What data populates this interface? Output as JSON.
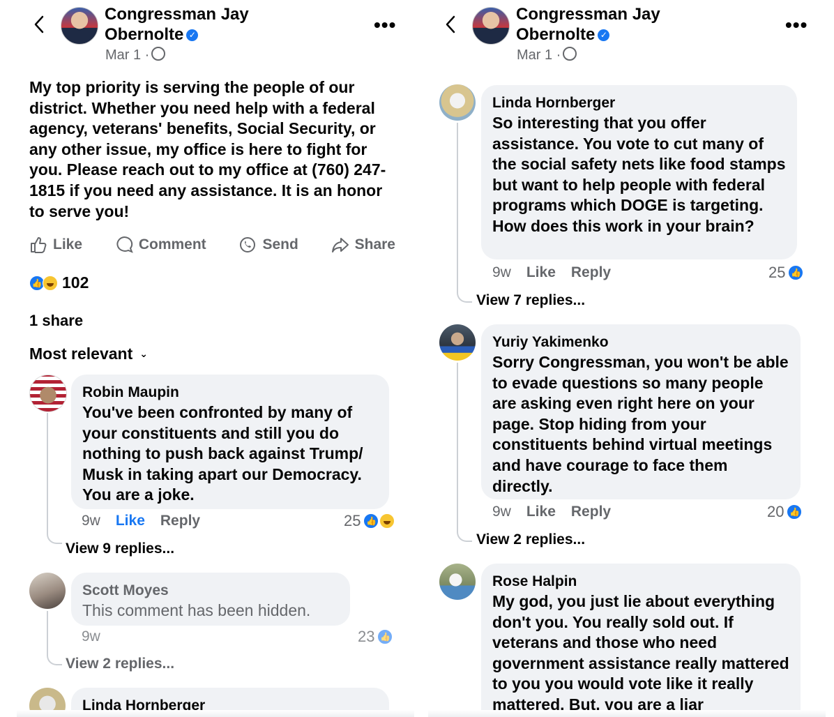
{
  "post": {
    "author": "Congressman Jay Obernolte",
    "author_line1": "Congressman Jay",
    "author_line2": "Obernolte",
    "date": "Mar 1 ·",
    "text": "My top priority is serving the people of our district. Whether you need help with a federal agency, veterans' benefits, Social Security, or any other issue, my office is here to fight for you. Please reach out to my office at (760) 247-1815 if you need any assistance. It is an honor to serve you!",
    "actions": {
      "like": "Like",
      "comment": "Comment",
      "send": "Send",
      "share": "Share"
    },
    "reaction_count": "102",
    "shares": "1 share",
    "sort_label": "Most relevant"
  },
  "left_comments": [
    {
      "name": "Robin Maupin",
      "text": "You've been confronted by many of your constituents and still you do nothing to push back against Trump/ Musk in taking apart our Democracy. You are a joke.",
      "time": "9w",
      "like": "Like",
      "reply": "Reply",
      "count": "25",
      "view_replies": "View 9 replies..."
    },
    {
      "name": "Scott Moyes",
      "text": "This comment has been hidden.",
      "time": "9w",
      "count": "23",
      "view_replies": "View 2 replies..."
    },
    {
      "name": "Linda Hornberger"
    }
  ],
  "right_comments": [
    {
      "name": "Linda Hornberger",
      "text": "So interesting that you offer assistance.  You vote to cut many of the social safety nets like food stamps but want to help people with federal programs which DOGE is targeting. How does this work in your brain?",
      "time": "9w",
      "like": "Like",
      "reply": "Reply",
      "count": "25",
      "view_replies": "View 7 replies..."
    },
    {
      "name": "Yuriy Yakimenko",
      "text": "Sorry Congressman, you won't be able to evade questions so many people are asking even right here on your page. Stop hiding from your constituents behind virtual meetings and have courage to face them directly.",
      "time": "9w",
      "like": "Like",
      "reply": "Reply",
      "count": "20",
      "view_replies": "View 2 replies..."
    },
    {
      "name": "Rose Halpin",
      "text": "My god, you just lie about everything don't you.  You really sold out.  If veterans and those who need government assistance really mattered to you you would vote like it really mattered.  But, you are a liar"
    }
  ],
  "colors": {
    "accent": "#1877f2",
    "bubble": "#f0f2f5",
    "muted": "#65676b"
  }
}
